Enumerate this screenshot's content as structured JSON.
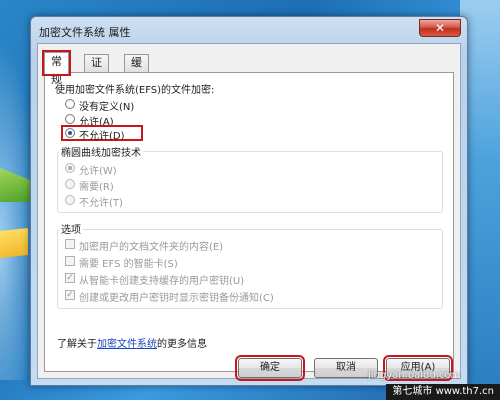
{
  "window": {
    "title": "加密文件系统 属性",
    "close_label": "✕"
  },
  "tabs": [
    {
      "label": "常规"
    },
    {
      "label": "证书"
    },
    {
      "label": "缓存"
    }
  ],
  "efs": {
    "label": "使用加密文件系统(EFS)的文件加密:",
    "options": [
      {
        "label": "没有定义(N)",
        "checked": false
      },
      {
        "label": "允许(A)",
        "checked": false
      },
      {
        "label": "不允许(D)",
        "checked": true
      }
    ]
  },
  "ecc": {
    "title": "椭圆曲线加密技术",
    "options": [
      {
        "label": "允许(W)",
        "checked": true
      },
      {
        "label": "需要(R)",
        "checked": false
      },
      {
        "label": "不允许(T)",
        "checked": false
      }
    ]
  },
  "options_group": {
    "title": "选项",
    "items": [
      {
        "label": "加密用户的文档文件夹的内容(E)",
        "checked": false
      },
      {
        "label": "需要 EFS 的智能卡(S)",
        "checked": false
      },
      {
        "label": "从智能卡创建支持缓存的用户密钥(U)",
        "checked": true
      },
      {
        "label": "创建或更改用户密钥时显示密钥备份通知(C)",
        "checked": true
      }
    ]
  },
  "more_info": {
    "prefix": "了解关于",
    "link": "加密文件系统",
    "suffix": "的更多信息"
  },
  "buttons": {
    "ok": "确定",
    "cancel": "取消",
    "apply": "应用(A)"
  },
  "watermark": {
    "baidu": "jingyan.baidu.com",
    "site": "第七城市",
    "site_url": "www.th7.cn"
  },
  "colors": {
    "highlight": "#c8161d",
    "link": "#1a46b8",
    "desktop": "#1d6fb4"
  }
}
